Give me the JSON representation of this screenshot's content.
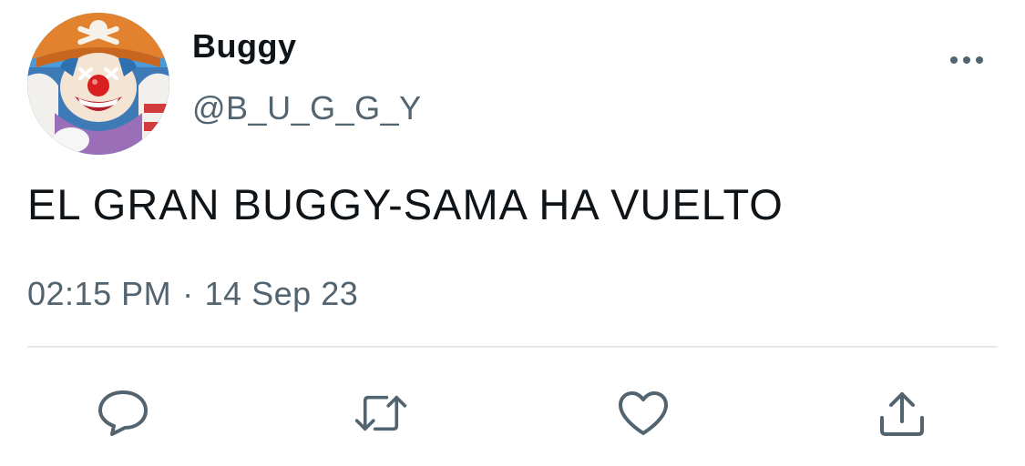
{
  "author": {
    "display_name": "Buggy",
    "handle": "@B_U_G_G_Y",
    "avatar_icon": "buggy-clown-avatar"
  },
  "tweet": {
    "text": "EL GRAN BUGGY-SAMA HA VUELTO",
    "time": "02:15 PM",
    "separator": "·",
    "date": "14 Sep 23"
  },
  "actions": [
    {
      "icon": "reply-icon"
    },
    {
      "icon": "retweet-icon"
    },
    {
      "icon": "like-icon"
    },
    {
      "icon": "share-icon"
    }
  ],
  "menu": {
    "icon": "more-options-icon"
  },
  "colors": {
    "text_primary": "#0f1419",
    "text_secondary": "#536471",
    "divider": "#e6e9eb",
    "icon": "#536471"
  }
}
